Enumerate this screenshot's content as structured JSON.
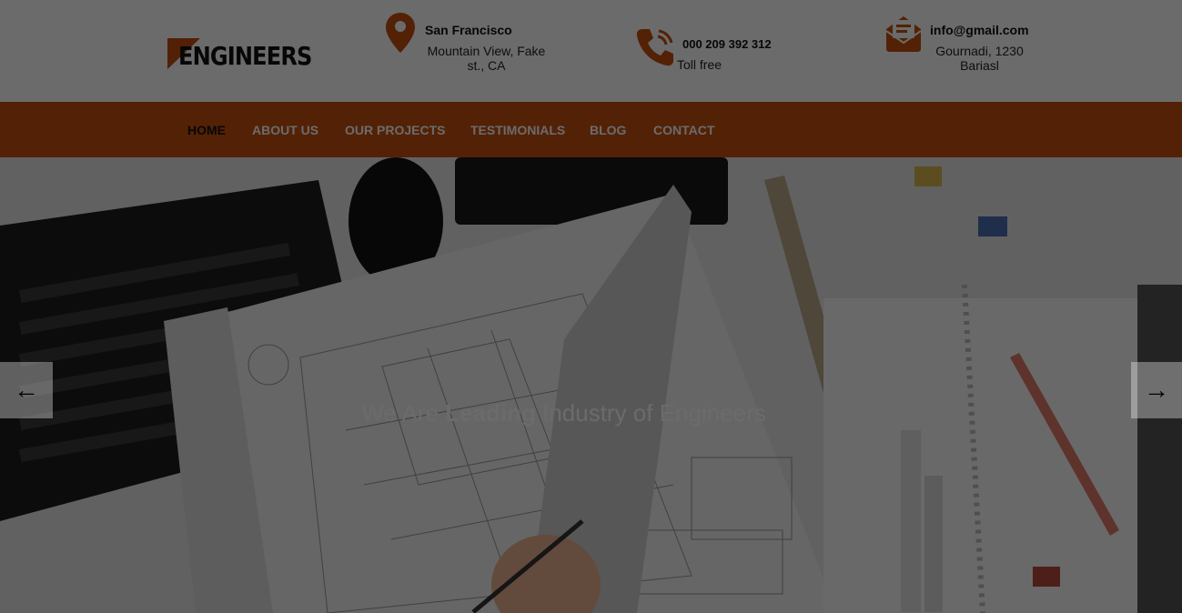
{
  "brand": {
    "name": "ENGINEERS"
  },
  "contact": {
    "location": {
      "icon": "map-pin-icon",
      "title": "San Francisco",
      "line1": "Mountain View, Fake",
      "line2": "st., CA"
    },
    "phone": {
      "icon": "phone-icon",
      "title": "000 209 392 312",
      "line1": "Toll free"
    },
    "email": {
      "icon": "envelope-icon",
      "title": "info@gmail.com",
      "line1": "Gournadi, 1230",
      "line2": "Bariasl"
    }
  },
  "nav": {
    "items": [
      {
        "label": "HOME",
        "active": true
      },
      {
        "label": "ABOUT US"
      },
      {
        "label": "OUR PROJECTS"
      },
      {
        "label": "TESTIMONIALS"
      },
      {
        "label": "BLOG"
      },
      {
        "label": "CONTACT"
      }
    ]
  },
  "hero": {
    "headline_pre": "We Are ",
    "headline_bold": "Leading",
    "headline_post": " Industry of Engineers",
    "prev_icon": "arrow-left-icon",
    "next_icon": "arrow-right-icon"
  },
  "colors": {
    "accent": "#c5500f",
    "overlay": "rgba(0,0,0,0.58)"
  }
}
